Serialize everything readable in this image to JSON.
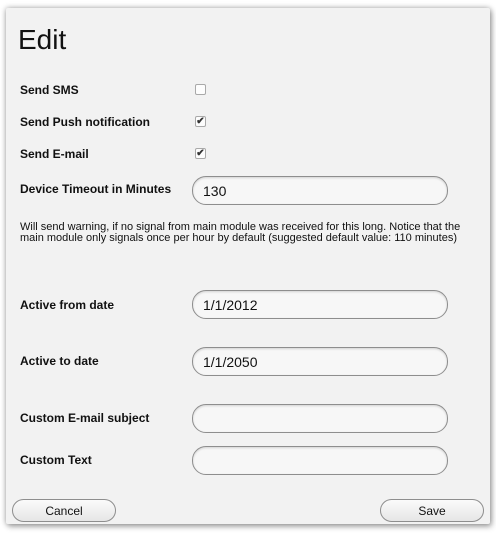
{
  "dialog": {
    "title": "Edit"
  },
  "fields": {
    "send_sms": {
      "label": "Send SMS",
      "checked": false
    },
    "send_push": {
      "label": "Send Push notification",
      "checked": true
    },
    "send_email": {
      "label": "Send E-mail",
      "checked": true
    },
    "device_timeout": {
      "label": "Device Timeout in Minutes",
      "value": "130"
    },
    "timeout_help": "Will send warning, if no signal from main module was received for this long. Notice that the main module only signals once per hour by default (suggested default value: 110 minutes)",
    "active_from": {
      "label": "Active from date",
      "value": "1/1/2012"
    },
    "active_to": {
      "label": "Active to date",
      "value": "1/1/2050"
    },
    "custom_subject": {
      "label": "Custom E-mail subject",
      "value": ""
    },
    "custom_text": {
      "label": "Custom Text",
      "value": ""
    }
  },
  "buttons": {
    "cancel": "Cancel",
    "save": "Save"
  },
  "icons": {
    "checkmark": "check-icon"
  }
}
